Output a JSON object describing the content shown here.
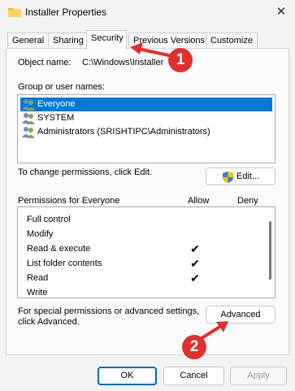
{
  "window": {
    "title": "Installer Properties",
    "close_glyph": "✕"
  },
  "tabs": [
    {
      "label": "General"
    },
    {
      "label": "Sharing"
    },
    {
      "label": "Security",
      "active": true
    },
    {
      "label": "Previous Versions"
    },
    {
      "label": "Customize"
    }
  ],
  "security": {
    "object_name_label": "Object name:",
    "object_name_value": "C:\\Windows\\Installer",
    "groups_label": "Group or user names:",
    "groups": [
      {
        "name": "Everyone",
        "selected": true,
        "icon": "users-icon"
      },
      {
        "name": "SYSTEM",
        "selected": false,
        "icon": "users-icon"
      },
      {
        "name": "Administrators (SRISHTIPC\\Administrators)",
        "selected": false,
        "icon": "users-icon"
      }
    ],
    "change_text": "To change permissions, click Edit.",
    "edit_button": "Edit...",
    "permissions_label": "Permissions for Everyone",
    "allow_header": "Allow",
    "deny_header": "Deny",
    "permissions": [
      {
        "name": "Full control",
        "allow": false,
        "deny": false
      },
      {
        "name": "Modify",
        "allow": false,
        "deny": false
      },
      {
        "name": "Read & execute",
        "allow": true,
        "deny": false
      },
      {
        "name": "List folder contents",
        "allow": true,
        "deny": false
      },
      {
        "name": "Read",
        "allow": true,
        "deny": false
      },
      {
        "name": "Write",
        "allow": false,
        "deny": false
      }
    ],
    "check_glyph": "✔",
    "advanced_text_line1": "For special permissions or advanced settings,",
    "advanced_text_line2": "click Advanced.",
    "advanced_button": "Advanced"
  },
  "footer": {
    "ok": "OK",
    "cancel": "Cancel",
    "apply": "Apply"
  },
  "annotations": [
    {
      "number": "1",
      "color": "#e0302e"
    },
    {
      "number": "2",
      "color": "#e0302e"
    }
  ],
  "colors": {
    "selection": "#0078d4",
    "accent_border": "#0067c0",
    "annotation": "#e0302e"
  }
}
